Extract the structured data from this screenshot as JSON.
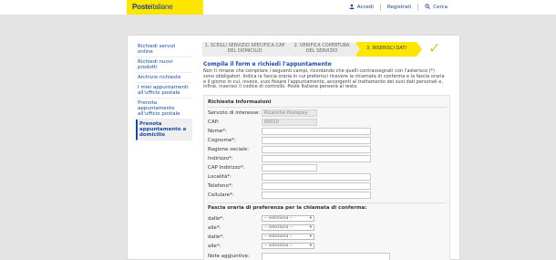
{
  "brand": {
    "logo_bold": "Poste",
    "logo_rest": "italiane",
    "accent": "#ffe600",
    "link_color": "#1a4aa0"
  },
  "topnav": {
    "accedi": "Accedi",
    "registrati": "Registrati",
    "cerca": "Cerca"
  },
  "sidebar": {
    "items": [
      {
        "label": "Richiedi servizi online"
      },
      {
        "label": "Richiedi nuovi prodotti"
      },
      {
        "label": "Archivio richieste"
      },
      {
        "label": "I miei appuntamenti all'ufficio postale"
      },
      {
        "label": "Prenota appuntamento all'ufficio postale"
      },
      {
        "label": "Prenota appuntamento a domicilio"
      }
    ]
  },
  "steps": [
    {
      "label": "1. SCEGLI SERVIZIO SPECIFICA CAP DEL DOMICILIO"
    },
    {
      "label": "2. VERIFICA COPERTURA DEL SERVIZIO"
    },
    {
      "label": "3. INSERISCI DATI"
    }
  ],
  "content": {
    "heading": "Compila il form e richiedi l'appuntamento",
    "intro": "Non ti rimane che compilare i seguenti campi, ricordando che quelli contrassegnati con l'asterisco (*) sono obbligatori. Indica la fascia oraria in cui preferisci ricevere la chiamata di conferma e la fascia oraria e il giorno in cui, invece, vuoi fissare l'appuntamento, accorgenti al trattamento dei suoi dati personali e, infine, inserisci il codice di controllo. Poste Italiane penserà al resto."
  },
  "form": {
    "section1": "Richiesta Informazioni",
    "fields": [
      {
        "label": "Servizio di interesse:",
        "value": "Ricariche Postepay",
        "readonly": true
      },
      {
        "label": "CAP:",
        "value": "00010",
        "readonly": true
      },
      {
        "label": "Nome*:",
        "value": ""
      },
      {
        "label": "Cognome*:",
        "value": ""
      },
      {
        "label": "Ragione sociale:",
        "value": ""
      },
      {
        "label": "Indirizzo*:",
        "value": ""
      },
      {
        "label": "CAP Indirizzo*:",
        "value": ""
      },
      {
        "label": "Località*:",
        "value": ""
      },
      {
        "label": "Telefono*:",
        "value": ""
      },
      {
        "label": "Cellulare*:",
        "value": ""
      }
    ],
    "section2": "Fascia oraria di preferenza per la chiamata di conferma:",
    "time_rows": [
      {
        "label": "dalle*:",
        "value": "-- seleziona --"
      },
      {
        "label": "alle*:",
        "value": "-- seleziona --"
      },
      {
        "label": "dalle*:",
        "value": "-- seleziona --"
      },
      {
        "label": "alle*:",
        "value": "-- seleziona --"
      }
    ],
    "notes_label": "Note aggiuntive:"
  }
}
